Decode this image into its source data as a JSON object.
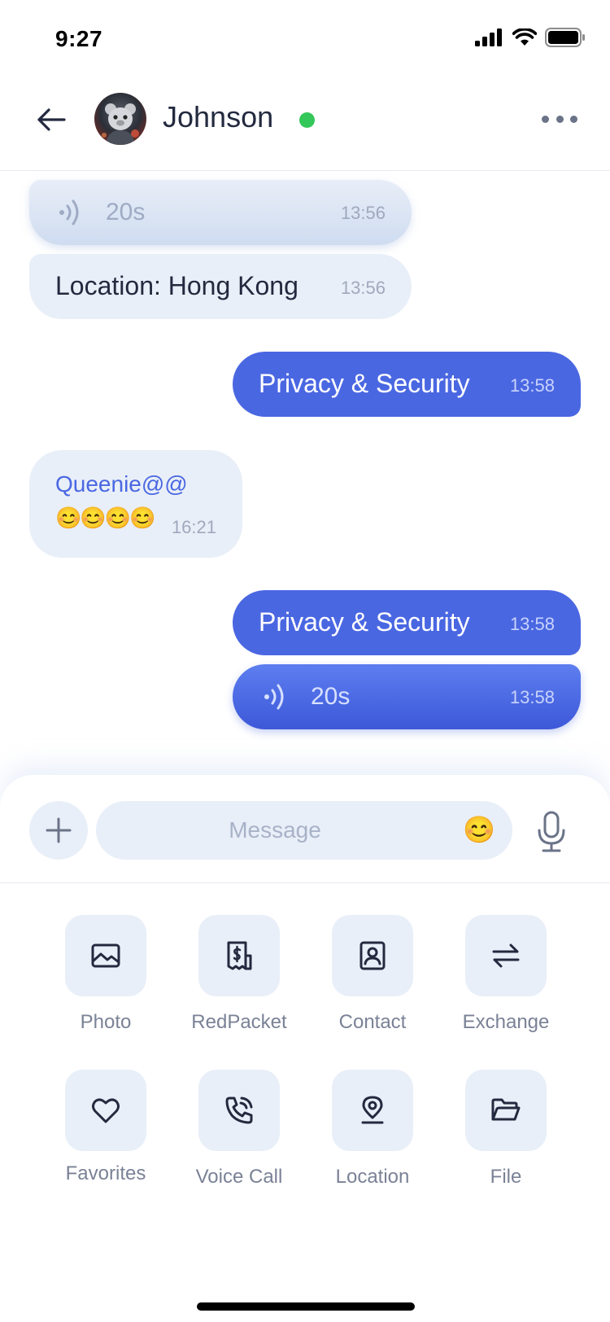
{
  "status_bar": {
    "time": "9:27",
    "icons": [
      "cellular-signal-icon",
      "wifi-icon",
      "battery-icon"
    ]
  },
  "header": {
    "name": "Johnson",
    "online": true,
    "icons": [
      "back-arrow-icon",
      "more-dots-icon"
    ]
  },
  "messages": [
    {
      "direction": "in",
      "type": "voice",
      "duration": "20s",
      "time": "13:56"
    },
    {
      "direction": "in",
      "type": "text",
      "text": "Location: Hong Kong",
      "time": "13:56"
    },
    {
      "direction": "out",
      "type": "text",
      "text": "Privacy & Security",
      "time": "13:58"
    },
    {
      "direction": "in",
      "type": "mention",
      "sender": "Queenie@@",
      "text": "😊😊😊😊",
      "time": "16:21"
    },
    {
      "direction": "out",
      "type": "text",
      "text": "Privacy & Security",
      "time": "13:58"
    },
    {
      "direction": "out",
      "type": "voice",
      "duration": "20s",
      "time": "13:58"
    }
  ],
  "composer": {
    "placeholder": "Message",
    "emoji": "😊",
    "icons": [
      "plus-icon",
      "smile-emoji-icon",
      "microphone-icon"
    ]
  },
  "actions": [
    {
      "label": "Photo",
      "icon": "photo-icon"
    },
    {
      "label": "RedPacket",
      "icon": "red-packet-icon"
    },
    {
      "label": "Contact",
      "icon": "contact-icon"
    },
    {
      "label": "Exchange",
      "icon": "exchange-icon"
    },
    {
      "label": "Favorites",
      "icon": "heart-icon"
    },
    {
      "label": "Voice Call",
      "icon": "phone-call-icon"
    },
    {
      "label": "Location",
      "icon": "location-pin-icon"
    },
    {
      "label": "File",
      "icon": "folder-icon"
    }
  ],
  "colors": {
    "accent": "#4a67e2",
    "bubble_in": "#e9eff8",
    "online": "#34c759",
    "text": "#232a3f",
    "muted": "#7a8296"
  }
}
